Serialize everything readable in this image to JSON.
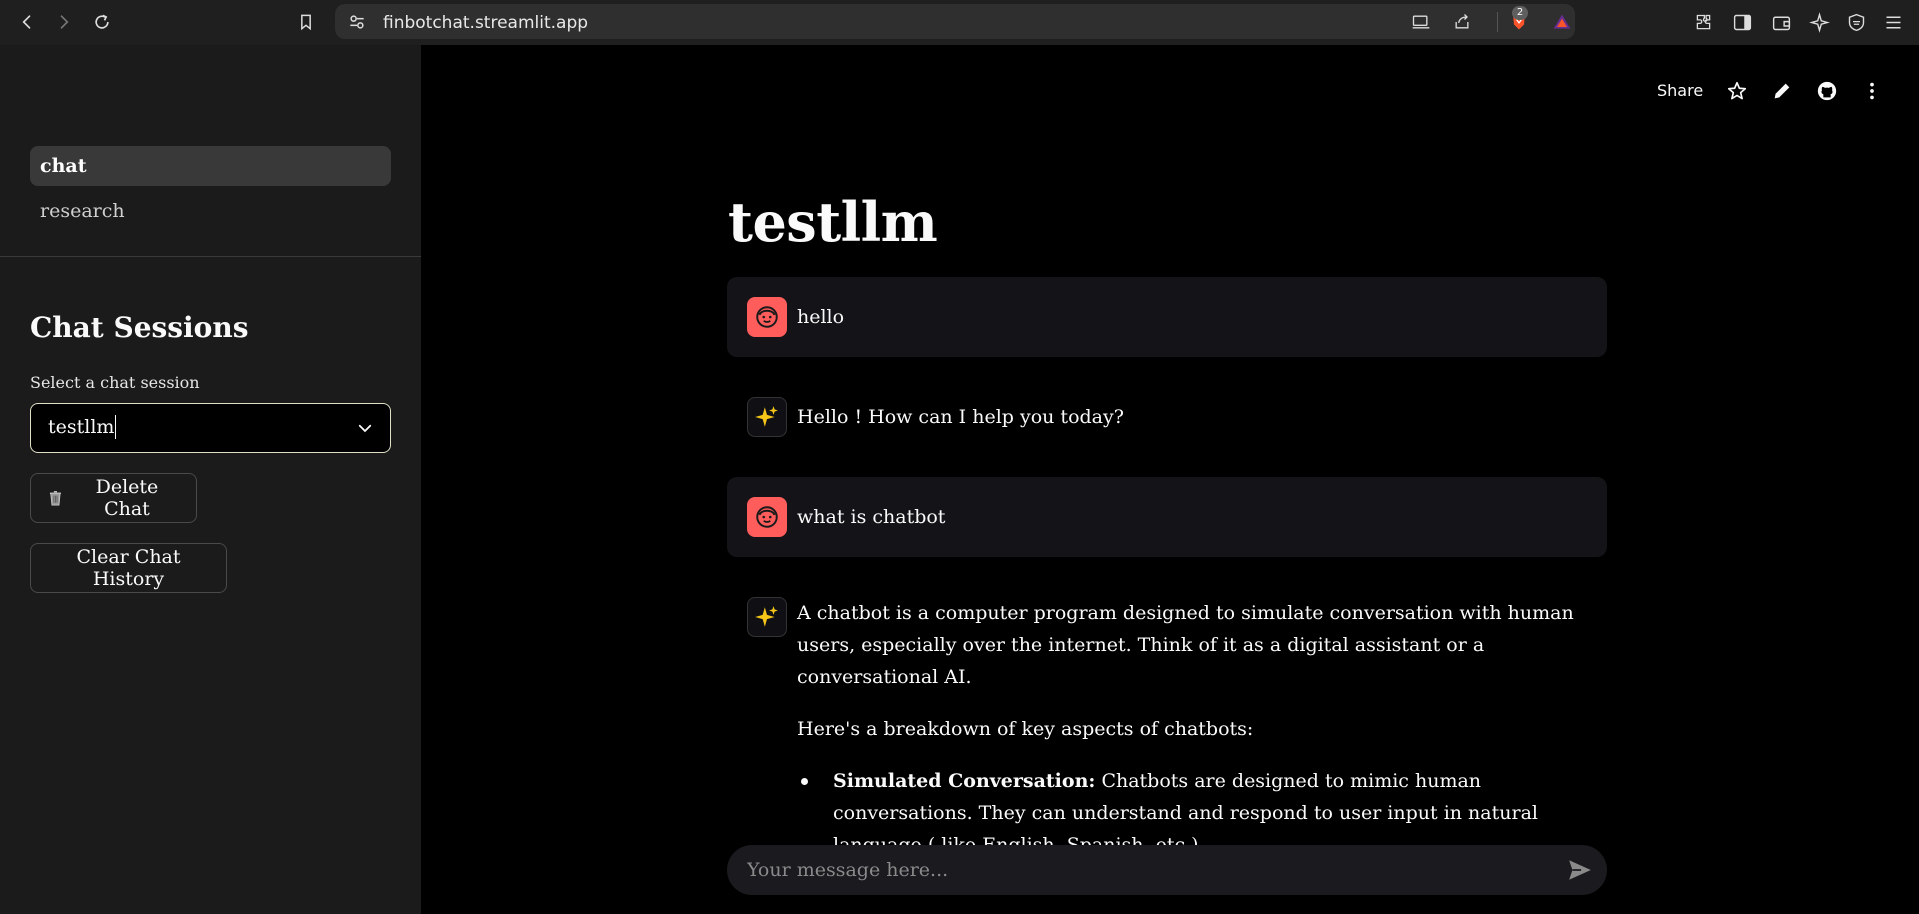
{
  "browser": {
    "url": "finbotchat.streamlit.app",
    "brave_badge_count": "2"
  },
  "sidebar": {
    "nav": [
      {
        "label": "chat",
        "active": true
      },
      {
        "label": "research",
        "active": false
      }
    ],
    "sessions_title": "Chat Sessions",
    "select_label": "Select a chat session",
    "select_value": "testllm",
    "delete_button": "Delete Chat",
    "clear_button": "Clear Chat History"
  },
  "header": {
    "share_label": "Share"
  },
  "main": {
    "title": "testllm",
    "messages": [
      {
        "role": "user",
        "text": "hello"
      },
      {
        "role": "assistant",
        "text": "Hello ! How can I help you today?"
      },
      {
        "role": "user",
        "text": "what is chatbot"
      },
      {
        "role": "assistant",
        "paragraph1": "A chatbot is a computer program designed to simulate conversation with human users, especially over the internet. Think of it as a digital assistant or a conversational AI.",
        "paragraph2": "Here's a breakdown of key aspects of chatbots:",
        "bullet_title": "Simulated Conversation:",
        "bullet_text": " Chatbots are designed to mimic human conversations. They can understand and respond to user input in natural language ( like English, Spanish, etc.)."
      }
    ],
    "input_placeholder": "Your message here..."
  },
  "colors": {
    "user_avatar": "#ff5c5c",
    "sidebar_bg": "#1b1b1b",
    "main_bg": "#000000"
  }
}
